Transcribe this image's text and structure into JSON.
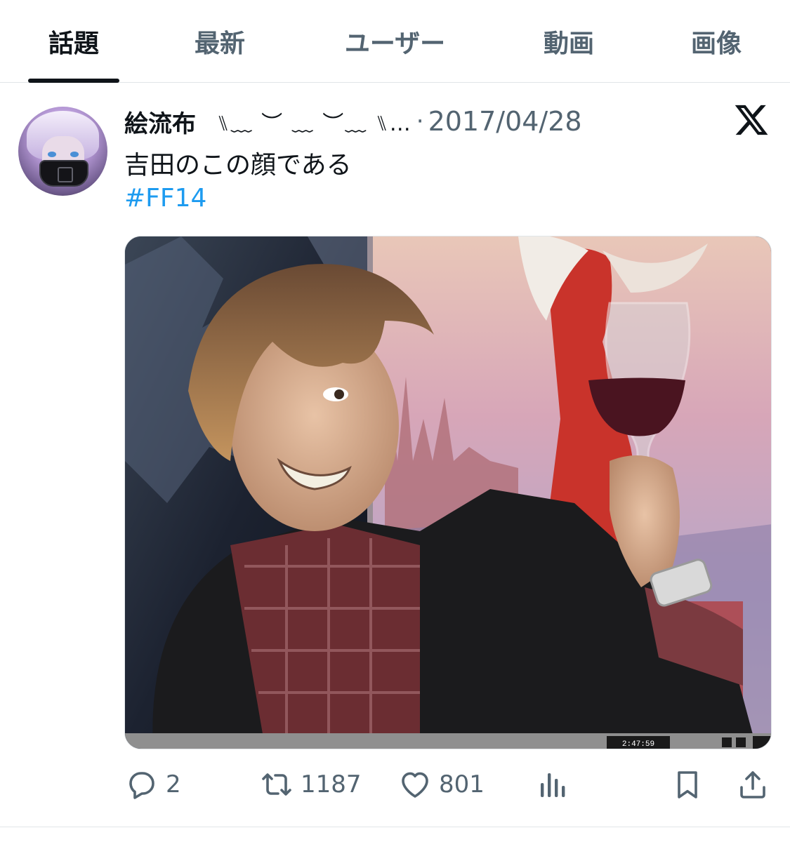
{
  "tabs": [
    {
      "label": "話題",
      "active": true
    },
    {
      "label": "最新",
      "active": false
    },
    {
      "label": "ユーザー",
      "active": false
    },
    {
      "label": "動画",
      "active": false
    },
    {
      "label": "画像",
      "active": false
    }
  ],
  "post": {
    "author_name": "絵流布",
    "author_name_deco": "ㅤ⑊﹏ ︶ ﹏ ︶﹏ ⑊…",
    "separator": "·",
    "date": "2017/04/28",
    "text": "吉田のこの顔である",
    "hashtag": "#FF14",
    "video_time": "2:47:59"
  },
  "actions": {
    "reply_count": "2",
    "retweet_count": "1187",
    "like_count": "801"
  },
  "icons": {
    "platform": "x-logo-icon",
    "reply": "reply-icon",
    "retweet": "retweet-icon",
    "like": "heart-icon",
    "views": "analytics-icon",
    "bookmark": "bookmark-icon",
    "share": "share-icon"
  },
  "colors": {
    "accent": "#1d9bf0",
    "text_primary": "#0f1419",
    "text_secondary": "#536471",
    "divider": "#e1e5e8"
  }
}
